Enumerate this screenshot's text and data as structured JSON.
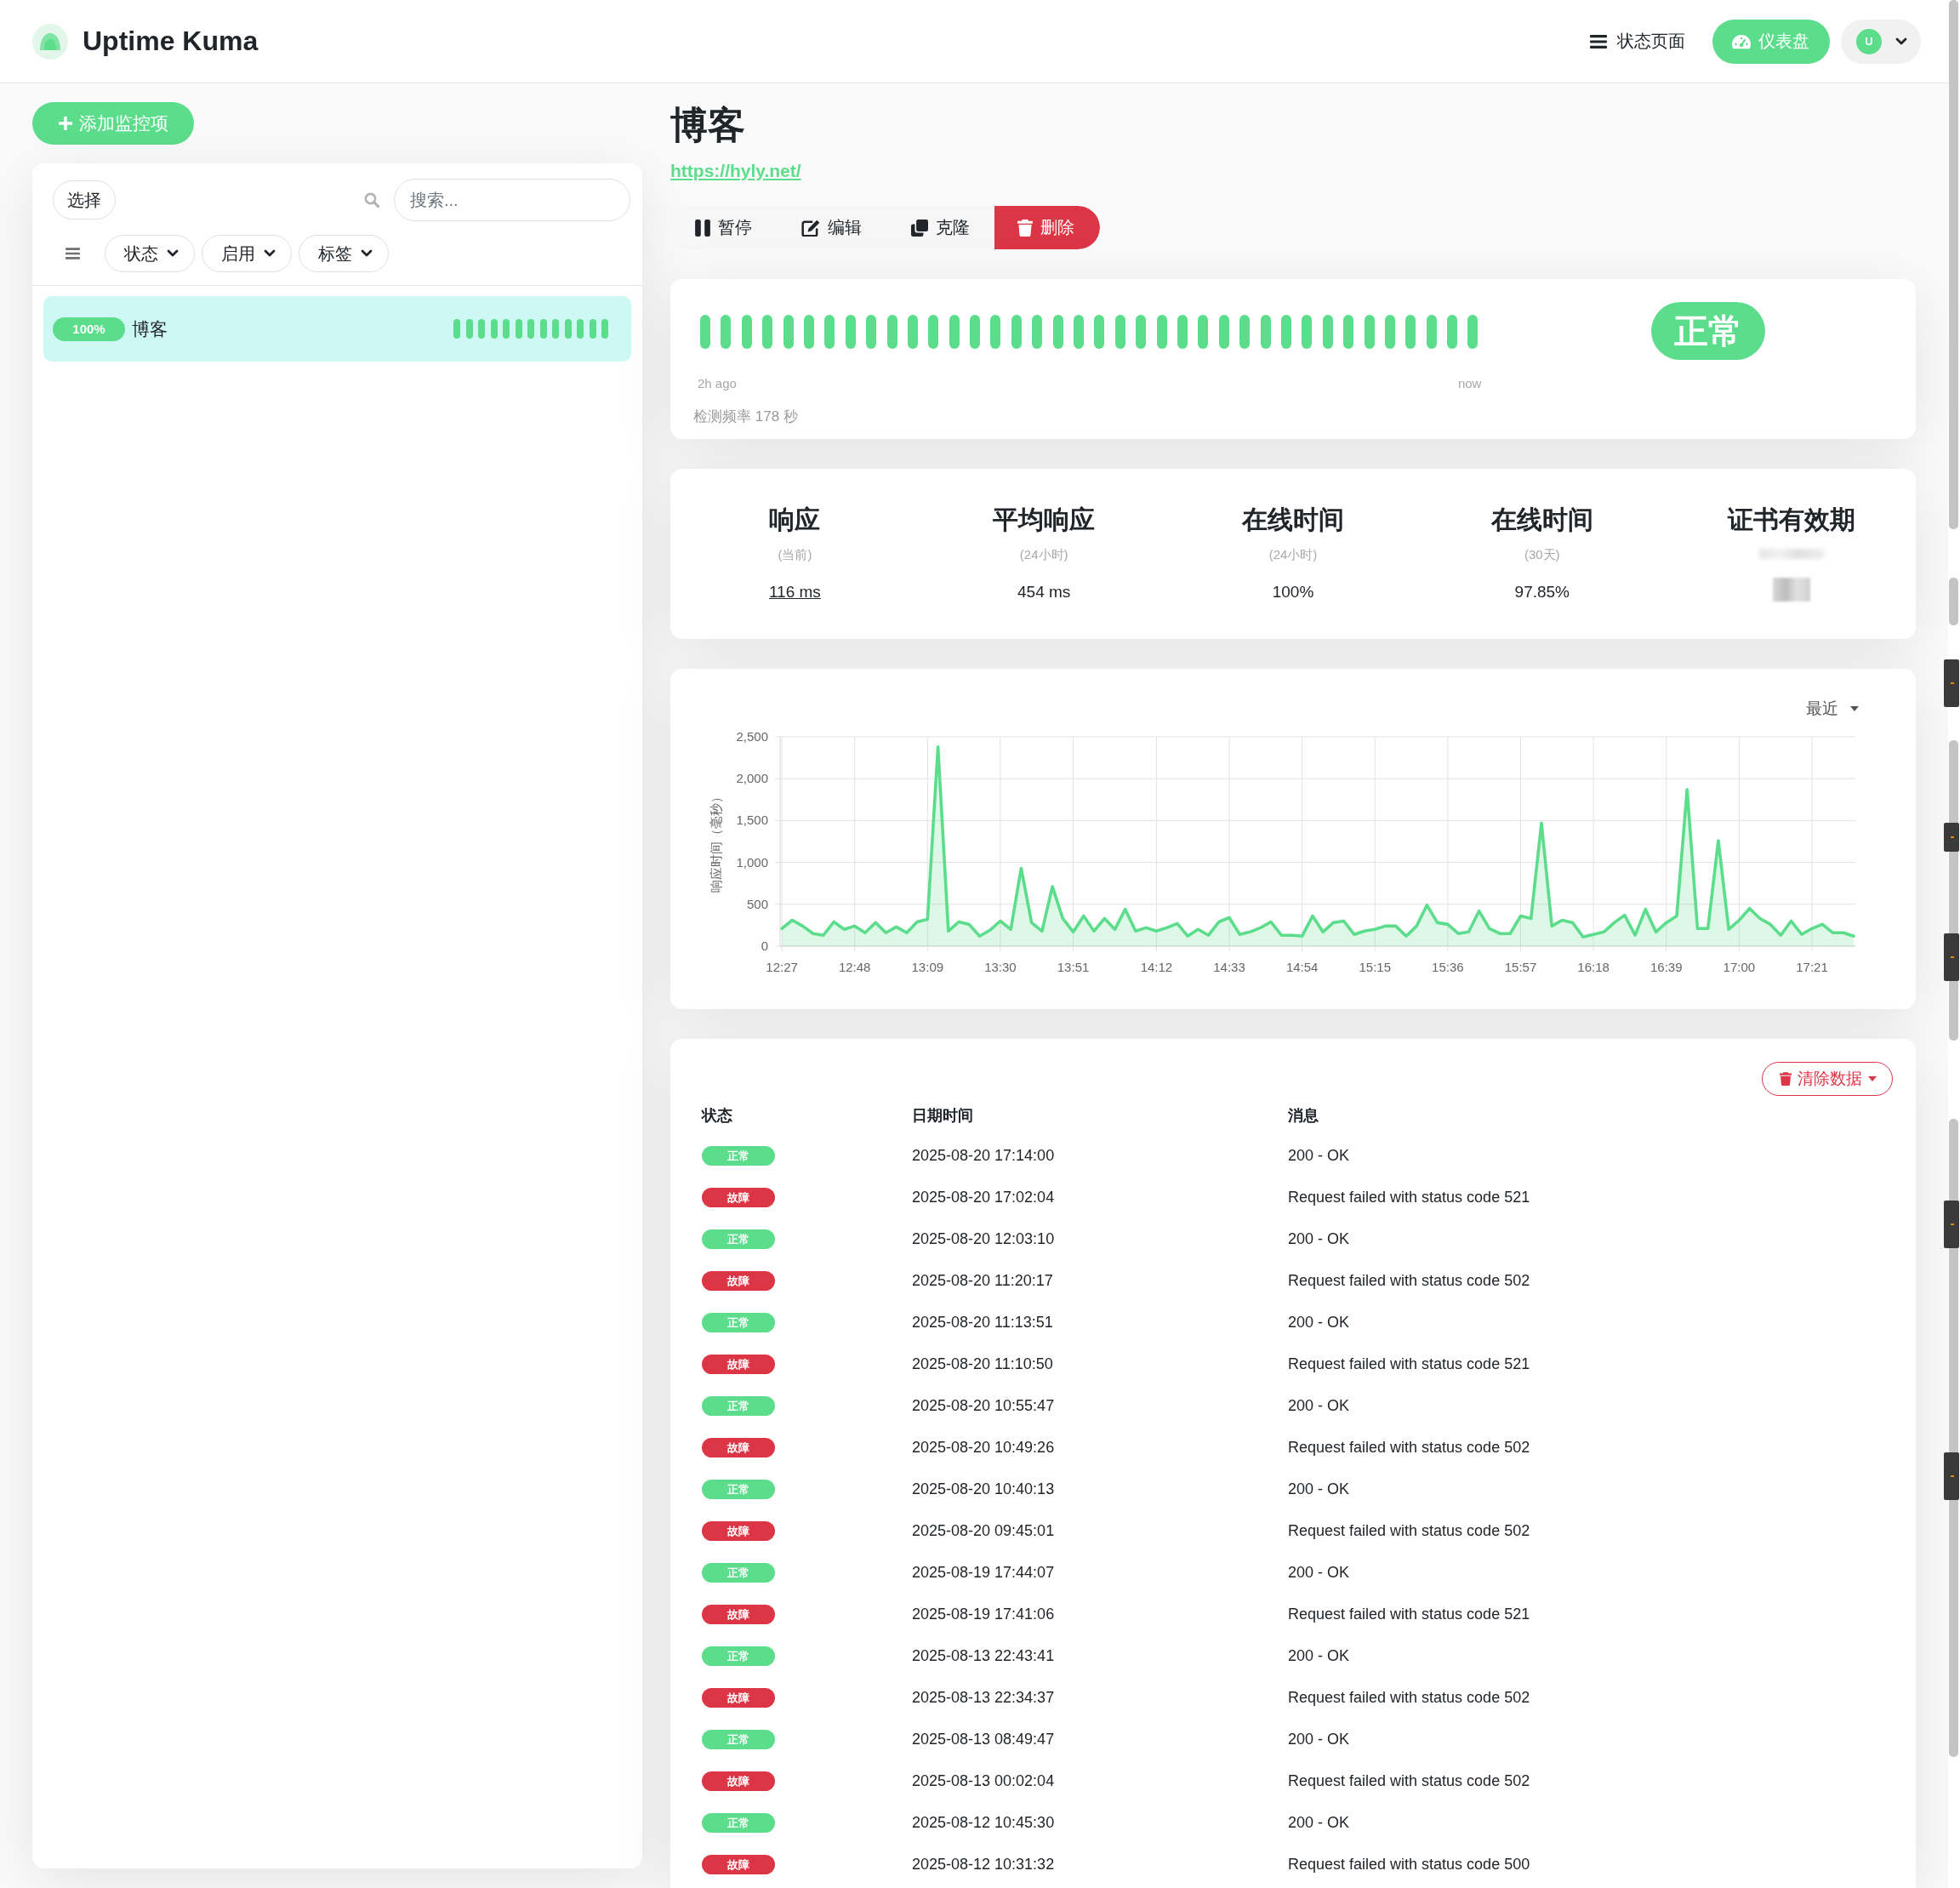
{
  "header": {
    "app_name": "Uptime Kuma",
    "status_page_link": "状态页面",
    "dashboard_button": "仪表盘",
    "user_initial": "U"
  },
  "sidebar": {
    "add_button": "添加监控项",
    "select_button": "选择",
    "search": {
      "placeholder": "搜索..."
    },
    "filters": [
      "状态",
      "启用",
      "标签"
    ],
    "monitors": [
      {
        "name": "博客",
        "uptime": "100%",
        "selected": true,
        "heartbeats": [
          {
            "up": true
          },
          {
            "up": true
          },
          {
            "up": true
          },
          {
            "up": true
          },
          {
            "up": true
          },
          {
            "up": true
          },
          {
            "up": true
          },
          {
            "up": true
          },
          {
            "up": true
          },
          {
            "up": true
          },
          {
            "up": true
          },
          {
            "up": true
          },
          {
            "up": true
          }
        ]
      }
    ]
  },
  "monitor": {
    "title": "博客",
    "url": "https://hyly.net/",
    "actions": [
      {
        "kind": "pause",
        "label": "暂停"
      },
      {
        "kind": "edit",
        "label": "编辑"
      },
      {
        "kind": "clone",
        "label": "克隆"
      },
      {
        "kind": "delete",
        "label": "删除"
      }
    ],
    "heartbeat_bar": {
      "beats": [
        {
          "up": true
        },
        {
          "up": true
        },
        {
          "up": true
        },
        {
          "up": true
        },
        {
          "up": true
        },
        {
          "up": true
        },
        {
          "up": true
        },
        {
          "up": true
        },
        {
          "up": true
        },
        {
          "up": true
        },
        {
          "up": true
        },
        {
          "up": true
        },
        {
          "up": true
        },
        {
          "up": true
        },
        {
          "up": true
        },
        {
          "up": true
        },
        {
          "up": true
        },
        {
          "up": true
        },
        {
          "up": true
        },
        {
          "up": true
        },
        {
          "up": true
        },
        {
          "up": true
        },
        {
          "up": true
        },
        {
          "up": true
        },
        {
          "up": true
        },
        {
          "up": true
        },
        {
          "up": true
        },
        {
          "up": true
        },
        {
          "up": true
        },
        {
          "up": true
        },
        {
          "up": true
        },
        {
          "up": true
        },
        {
          "up": true
        },
        {
          "up": true
        },
        {
          "up": true
        },
        {
          "up": true
        },
        {
          "up": true
        },
        {
          "up": true
        }
      ],
      "start_label": "2h ago",
      "end_label": "now",
      "interval": "检测频率 178 秒",
      "up": true,
      "status_label": "正常"
    },
    "stats": [
      {
        "title": "响应",
        "subtitle": "(当前)",
        "value": "116 ms",
        "link": true,
        "redacted": false
      },
      {
        "title": "平均响应",
        "subtitle": "(24小时)",
        "value": "454 ms",
        "link": false,
        "redacted": false
      },
      {
        "title": "在线时间",
        "subtitle": "(24小时)",
        "value": "100%",
        "link": false,
        "redacted": false
      },
      {
        "title": "在线时间",
        "subtitle": "(30天)",
        "value": "97.85%",
        "link": false,
        "redacted": false
      },
      {
        "title": "证书有效期",
        "redacted": true
      }
    ],
    "chart": {
      "period_dropdown": "最近",
      "chart_data": {
        "type": "area",
        "ylabel": "响应时间（毫秒）",
        "grid": true,
        "categories": [
          "12:27",
          null,
          null,
          null,
          null,
          null,
          null,
          "12:48",
          null,
          null,
          null,
          null,
          null,
          null,
          "13:09",
          null,
          null,
          null,
          null,
          null,
          null,
          "13:30",
          null,
          null,
          null,
          null,
          null,
          null,
          "13:51",
          null,
          null,
          null,
          null,
          null,
          null,
          null,
          "14:12",
          null,
          null,
          null,
          null,
          null,
          null,
          "14:33",
          null,
          null,
          null,
          null,
          null,
          null,
          "14:54",
          null,
          null,
          null,
          null,
          null,
          null,
          "15:15",
          null,
          null,
          null,
          null,
          null,
          null,
          "15:36",
          null,
          null,
          null,
          null,
          null,
          null,
          "15:57",
          null,
          null,
          null,
          null,
          null,
          null,
          "16:18",
          null,
          null,
          null,
          null,
          null,
          null,
          "16:39",
          null,
          null,
          null,
          null,
          null,
          null,
          "17:00",
          null,
          null,
          null,
          null,
          null,
          null,
          "17:21",
          null,
          null,
          null,
          null
        ],
        "series": [
          {
            "color": "#5cdd8b",
            "values": [
              210,
              310,
              240,
              150,
              130,
              290,
              200,
              240,
              160,
              280,
              160,
              230,
              160,
              290,
              320,
              2380,
              180,
              290,
              260,
              120,
              190,
              300,
              200,
              930,
              280,
              180,
              710,
              330,
              170,
              360,
              180,
              330,
              200,
              440,
              180,
              220,
              180,
              220,
              270,
              120,
              200,
              130,
              290,
              340,
              140,
              170,
              220,
              290,
              130,
              130,
              120,
              360,
              170,
              280,
              300,
              140,
              180,
              200,
              240,
              240,
              120,
              240,
              490,
              280,
              260,
              150,
              170,
              420,
              210,
              150,
              150,
              360,
              330,
              1470,
              240,
              310,
              280,
              110,
              140,
              170,
              280,
              370,
              130,
              440,
              170,
              280,
              360,
              1870,
              210,
              210,
              1260,
              200,
              310,
              450,
              330,
              260,
              130,
              300,
              140,
              210,
              260,
              160,
              160,
              120
            ]
          }
        ],
        "ylim": [
          0,
          2500
        ],
        "yticks": [
          {
            "value": 0,
            "label": "0"
          },
          {
            "value": 500,
            "label": "500"
          },
          {
            "value": 1000,
            "label": "1,000"
          },
          {
            "value": 1500,
            "label": "1,500"
          },
          {
            "value": 2000,
            "label": "2,000"
          },
          {
            "value": 2500,
            "label": "2,500"
          }
        ]
      }
    },
    "events": {
      "clear_button": "清除数据",
      "columns": [
        "状态",
        "日期时间",
        "消息"
      ],
      "rows": [
        {
          "up": true,
          "label": "正常",
          "datetime": "2025-08-20 17:14:00",
          "message": "200 - OK"
        },
        {
          "up": false,
          "label": "故障",
          "datetime": "2025-08-20 17:02:04",
          "message": "Request failed with status code 521"
        },
        {
          "up": true,
          "label": "正常",
          "datetime": "2025-08-20 12:03:10",
          "message": "200 - OK"
        },
        {
          "up": false,
          "label": "故障",
          "datetime": "2025-08-20 11:20:17",
          "message": "Request failed with status code 502"
        },
        {
          "up": true,
          "label": "正常",
          "datetime": "2025-08-20 11:13:51",
          "message": "200 - OK"
        },
        {
          "up": false,
          "label": "故障",
          "datetime": "2025-08-20 11:10:50",
          "message": "Request failed with status code 521"
        },
        {
          "up": true,
          "label": "正常",
          "datetime": "2025-08-20 10:55:47",
          "message": "200 - OK"
        },
        {
          "up": false,
          "label": "故障",
          "datetime": "2025-08-20 10:49:26",
          "message": "Request failed with status code 502"
        },
        {
          "up": true,
          "label": "正常",
          "datetime": "2025-08-20 10:40:13",
          "message": "200 - OK"
        },
        {
          "up": false,
          "label": "故障",
          "datetime": "2025-08-20 09:45:01",
          "message": "Request failed with status code 502"
        },
        {
          "up": true,
          "label": "正常",
          "datetime": "2025-08-19 17:44:07",
          "message": "200 - OK"
        },
        {
          "up": false,
          "label": "故障",
          "datetime": "2025-08-19 17:41:06",
          "message": "Request failed with status code 521"
        },
        {
          "up": true,
          "label": "正常",
          "datetime": "2025-08-13 22:43:41",
          "message": "200 - OK"
        },
        {
          "up": false,
          "label": "故障",
          "datetime": "2025-08-13 22:34:37",
          "message": "Request failed with status code 502"
        },
        {
          "up": true,
          "label": "正常",
          "datetime": "2025-08-13 08:49:47",
          "message": "200 - OK"
        },
        {
          "up": false,
          "label": "故障",
          "datetime": "2025-08-13 00:02:04",
          "message": "Request failed with status code 502"
        },
        {
          "up": true,
          "label": "正常",
          "datetime": "2025-08-12 10:45:30",
          "message": "200 - OK"
        },
        {
          "up": false,
          "label": "故障",
          "datetime": "2025-08-12 10:31:32",
          "message": "Request failed with status code 500"
        }
      ]
    }
  }
}
